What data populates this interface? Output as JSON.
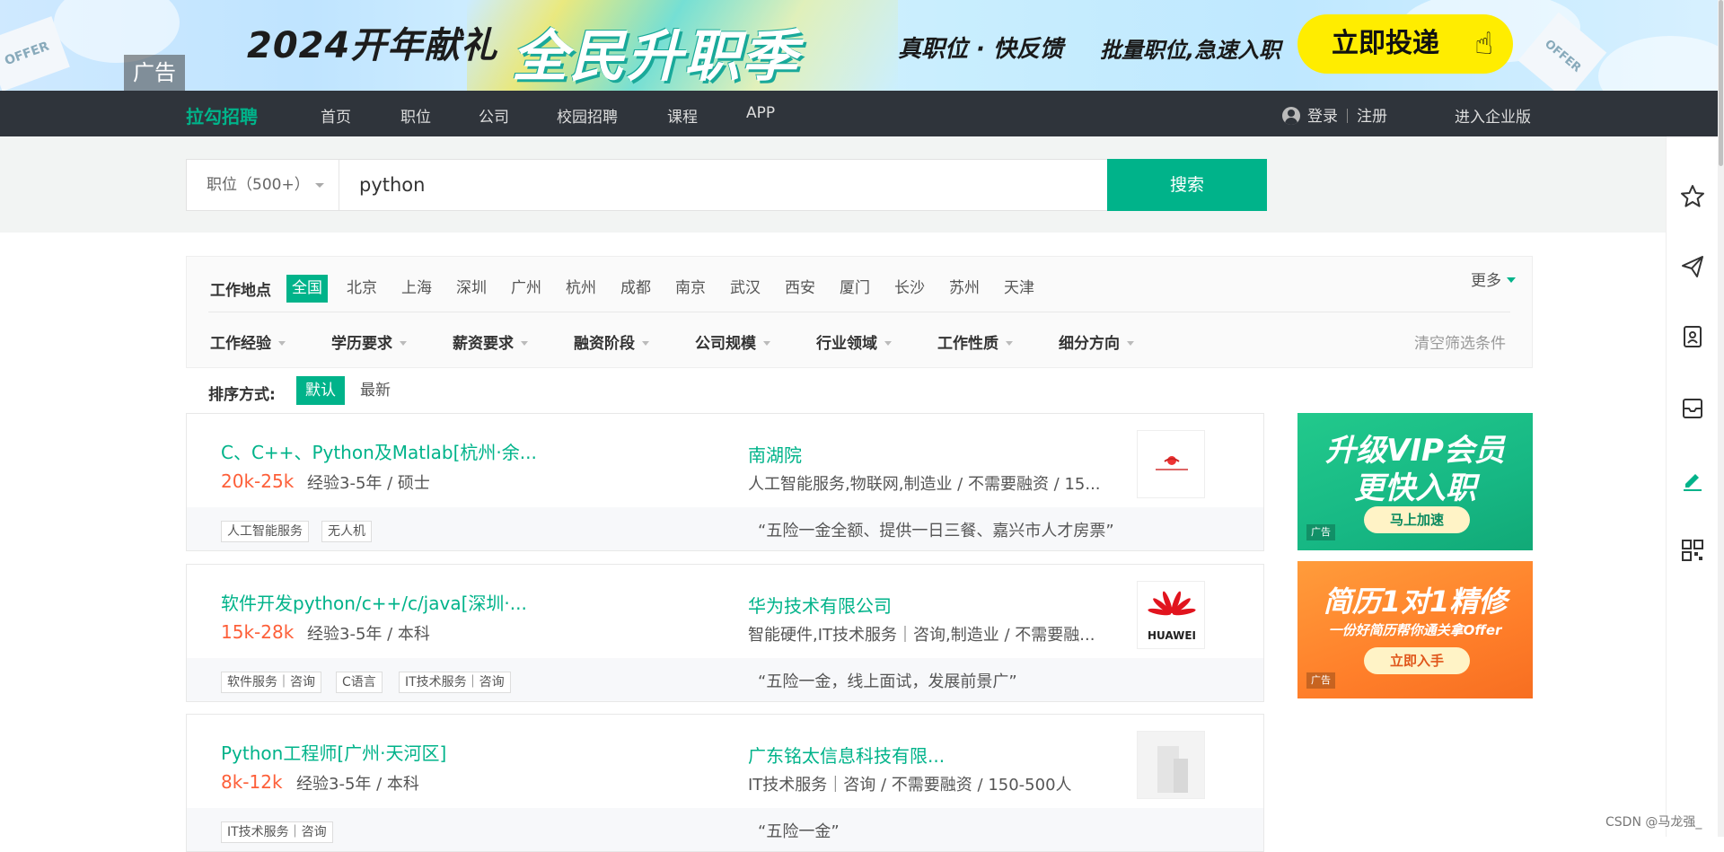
{
  "banner": {
    "ad_label": "广告",
    "title_left": "2024开年献礼",
    "title_main": "全民升职季",
    "subtitle": "真职位 · 快反馈",
    "subtitle2": "批量职位,急速入职",
    "cta": "立即投递",
    "offer_text": "OFFER"
  },
  "topnav": {
    "logo": "拉勾招聘",
    "links": [
      "首页",
      "职位",
      "公司",
      "校园招聘",
      "课程",
      "APP"
    ],
    "login": "登录",
    "register": "注册",
    "enterprise": "进入企业版"
  },
  "search": {
    "type_label": "职位（500+）",
    "query": "python",
    "button": "搜索"
  },
  "filters": {
    "location_label": "工作地点",
    "cities": [
      "全国",
      "北京",
      "上海",
      "深圳",
      "广州",
      "杭州",
      "成都",
      "南京",
      "武汉",
      "西安",
      "厦门",
      "长沙",
      "苏州",
      "天津"
    ],
    "active_city": "全国",
    "more": "更多",
    "dropdowns": [
      "工作经验",
      "学历要求",
      "薪资要求",
      "融资阶段",
      "公司规模",
      "行业领域",
      "工作性质",
      "细分方向"
    ],
    "clear": "清空筛选条件"
  },
  "sort": {
    "label": "排序方式:",
    "options": [
      "默认",
      "最新"
    ],
    "active": "默认"
  },
  "jobs": [
    {
      "title": "C、C++、Python及Matlab[杭州·余...",
      "salary": "20k-25k",
      "requirements": "经验3-5年 / 硕士",
      "company": "南湖院",
      "industry": "人工智能服务,物联网,制造业 / 不需要融资 / 15...",
      "tags": [
        "人工智能服务",
        "无人机"
      ],
      "welfare": "“五险一金全额、提供一日三餐、嘉兴市人才房票”"
    },
    {
      "title": "软件开发python/c++/c/java[深圳·...",
      "salary": "15k-28k",
      "requirements": "经验3-5年 / 本科",
      "company": "华为技术有限公司",
      "industry": "智能硬件,IT技术服务｜咨询,制造业 / 不需要融...",
      "tags": [
        "软件服务｜咨询",
        "C语言",
        "IT技术服务｜咨询"
      ],
      "welfare": "“五险一金，线上面试，发展前景广”",
      "logo_text": "HUAWEI"
    },
    {
      "title": "Python工程师[广州·天河区]",
      "salary": "8k-12k",
      "requirements": "经验3-5年 / 本科",
      "company": "广东铭太信息科技有限...",
      "industry": "IT技术服务｜咨询 / 不需要融资 / 150-500人",
      "tags": [
        "IT技术服务｜咨询"
      ],
      "welfare": "“五险一金”"
    }
  ],
  "ads": {
    "vip_line1": "升级VIP会员",
    "vip_line2": "更快入职",
    "vip_btn": "马上加速",
    "cv_line1": "简历1对1精修",
    "cv_line2": "一份好简历帮你通关拿Offer",
    "cv_btn": "立即入手",
    "ad_label": "广告"
  },
  "watermark": "CSDN @马龙强_",
  "colors": {
    "brand": "#00b38a",
    "salary": "#fd5f39",
    "nav_bg": "#2f343b"
  }
}
